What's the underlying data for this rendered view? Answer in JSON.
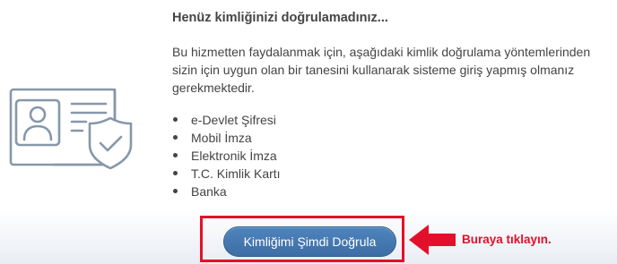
{
  "notice": {
    "title": "Henüz kimliğinizi doğrulamadınız...",
    "description": "Bu hizmetten faydalanmak için, aşağıdaki kimlik doğrulama yöntemlerinden sizin için uygun olan bir tanesini kullanarak sisteme giriş yapmış olmanız gerekmektedir.",
    "methods": [
      "e-Devlet Şifresi",
      "Mobil İmza",
      "Elektronik İmza",
      "T.C. Kimlik Kartı",
      "Banka"
    ]
  },
  "actions": {
    "verify_label": "Kimliğimi Şimdi Doğrula",
    "hint": "Buraya tıklayın."
  },
  "icons": {
    "illustration": "id-card-shield-icon",
    "pointer": "red-arrow-left-icon"
  },
  "colors": {
    "accent": "#e3102b",
    "button": "#3f72a9",
    "illustration": "#8797aa"
  }
}
